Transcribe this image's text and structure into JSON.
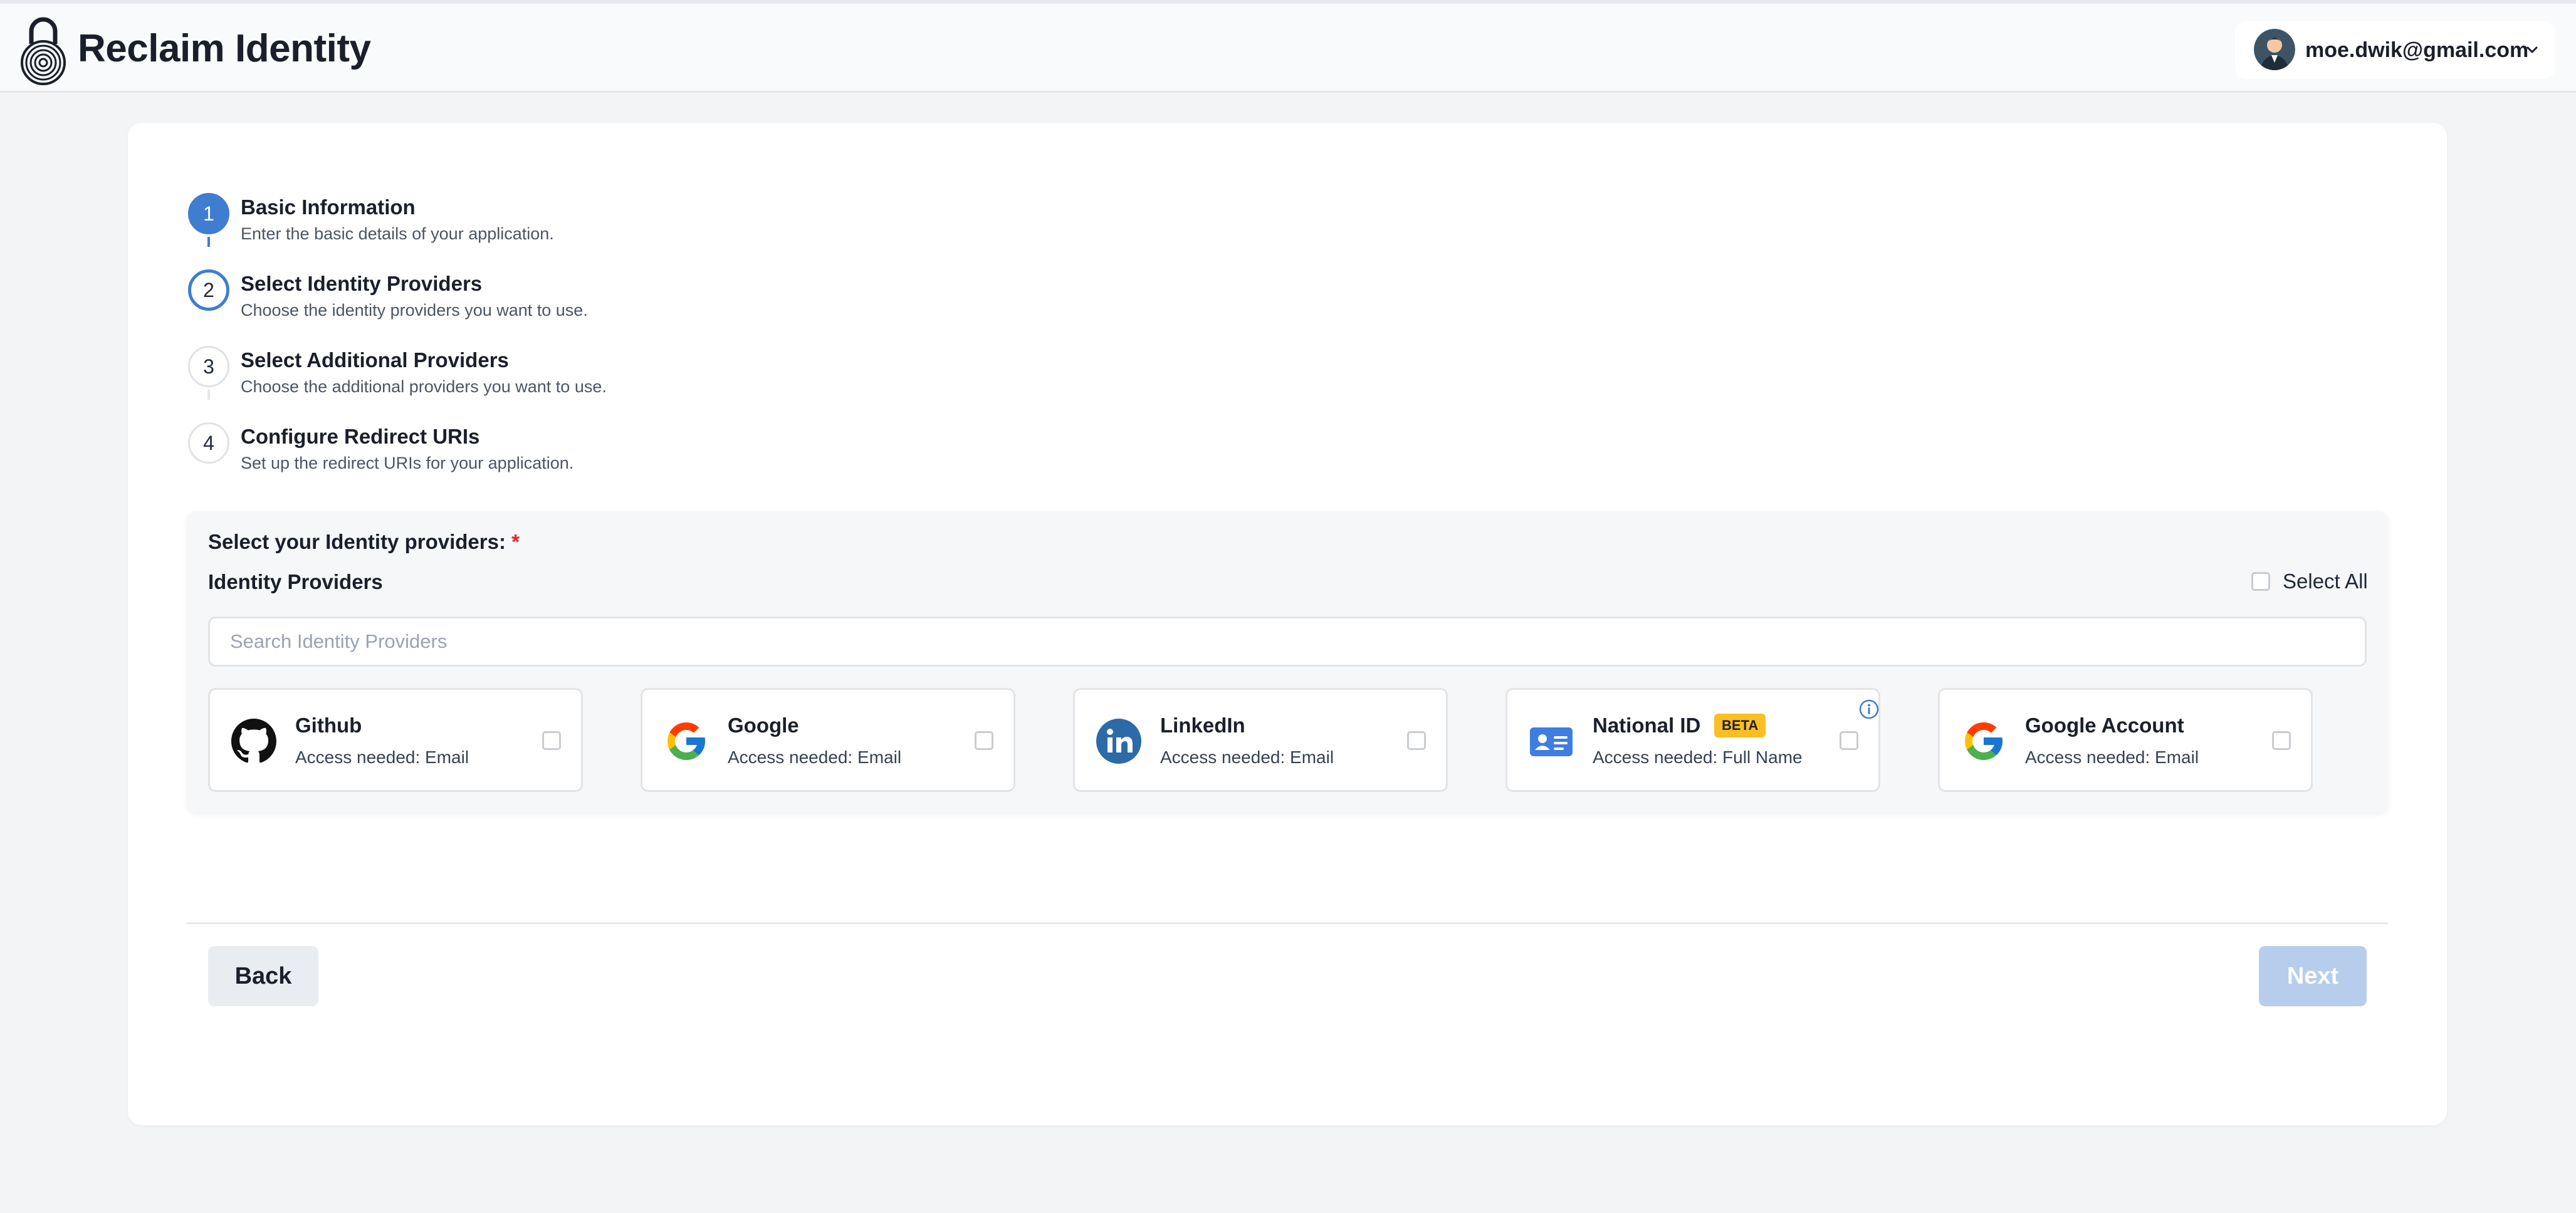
{
  "header": {
    "app_title": "Reclaim Identity",
    "account_email": "moe.dwik@gmail.com"
  },
  "steps": [
    {
      "number": "1",
      "title": "Basic Information",
      "description": "Enter the basic details of your application.",
      "state": "completed"
    },
    {
      "number": "2",
      "title": "Select Identity Providers",
      "description": "Choose the identity providers you want to use.",
      "state": "current"
    },
    {
      "number": "3",
      "title": "Select Additional Providers",
      "description": "Choose the additional providers you want to use.",
      "state": "upcoming"
    },
    {
      "number": "4",
      "title": "Configure Redirect URIs",
      "description": "Set up the redirect URIs for your application.",
      "state": "upcoming"
    }
  ],
  "panel": {
    "prompt": "Select your Identity providers:",
    "required_mark": "*",
    "heading": "Identity Providers",
    "select_all_label": "Select All",
    "search_placeholder": "Search Identity Providers"
  },
  "providers": [
    {
      "name": "Github",
      "access": "Access needed: Email",
      "icon": "github-icon",
      "checked": false
    },
    {
      "name": "Google",
      "access": "Access needed: Email",
      "icon": "google-icon",
      "checked": false
    },
    {
      "name": "LinkedIn",
      "access": "Access needed: Email",
      "icon": "linkedin-icon",
      "checked": false
    },
    {
      "name": "National ID",
      "access": "Access needed: Full Name",
      "icon": "id-card-icon",
      "badge": "BETA",
      "checked": false
    },
    {
      "name": "Google Account",
      "access": "Access needed: Email",
      "icon": "google-icon",
      "checked": false
    }
  ],
  "footer": {
    "back_label": "Back",
    "next_label": "Next"
  },
  "colors": {
    "accent": "#3f7dd1",
    "beta_badge": "#fbbf24",
    "next_disabled": "#b6cdeb",
    "required": "#dc2626"
  }
}
